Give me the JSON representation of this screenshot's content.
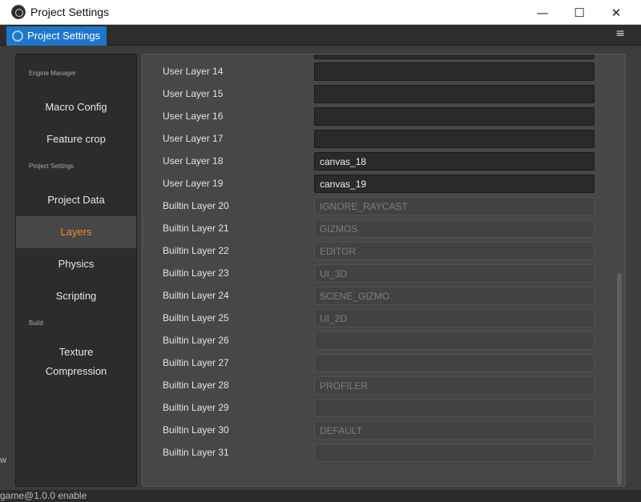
{
  "window": {
    "title": "Project Settings",
    "controls": {
      "minimize": "—",
      "maximize": "☐",
      "close": "✕"
    }
  },
  "tab": {
    "label": "Project Settings",
    "menu_glyph": "≡"
  },
  "sidebar": {
    "groups": {
      "engine_manager": "Engine Manager",
      "project_settings": "Project Settings",
      "build": "Build"
    },
    "items": {
      "macro_config": "Macro Config",
      "feature_crop": "Feature crop",
      "project_data": "Project Data",
      "layers": "Layers",
      "physics": "Physics",
      "scripting": "Scripting",
      "texture_compression_line1": "Texture",
      "texture_compression_line2": "Compression"
    },
    "active_item": "Layers"
  },
  "layers": [
    {
      "label": "User Layer 14",
      "value": "",
      "editable": true
    },
    {
      "label": "User Layer 15",
      "value": "",
      "editable": true
    },
    {
      "label": "User Layer 16",
      "value": "",
      "editable": true
    },
    {
      "label": "User Layer 17",
      "value": "",
      "editable": true
    },
    {
      "label": "User Layer 18",
      "value": "canvas_18",
      "editable": true
    },
    {
      "label": "User Layer 19",
      "value": "canvas_19",
      "editable": true
    },
    {
      "label": "Builtin Layer 20",
      "value": "IGNORE_RAYCAST",
      "editable": false
    },
    {
      "label": "Builtin Layer 21",
      "value": "GIZMOS",
      "editable": false
    },
    {
      "label": "Builtin Layer 22",
      "value": "EDITOR",
      "editable": false
    },
    {
      "label": "Builtin Layer 23",
      "value": "UI_3D",
      "editable": false
    },
    {
      "label": "Builtin Layer 24",
      "value": "SCENE_GIZMO",
      "editable": false
    },
    {
      "label": "Builtin Layer 25",
      "value": "UI_2D",
      "editable": false
    },
    {
      "label": "Builtin Layer 26",
      "value": "",
      "editable": false
    },
    {
      "label": "Builtin Layer 27",
      "value": "",
      "editable": false
    },
    {
      "label": "Builtin Layer 28",
      "value": "PROFILER",
      "editable": false
    },
    {
      "label": "Builtin Layer 29",
      "value": "",
      "editable": false
    },
    {
      "label": "Builtin Layer 30",
      "value": "DEFAULT",
      "editable": false
    },
    {
      "label": "Builtin Layer 31",
      "value": "",
      "editable": false
    }
  ],
  "background": {
    "status_text": "game@1.0.0 enable",
    "left_edge_text": "w"
  },
  "colors": {
    "accent": "#1f76c9",
    "active_text": "#f08a24"
  }
}
